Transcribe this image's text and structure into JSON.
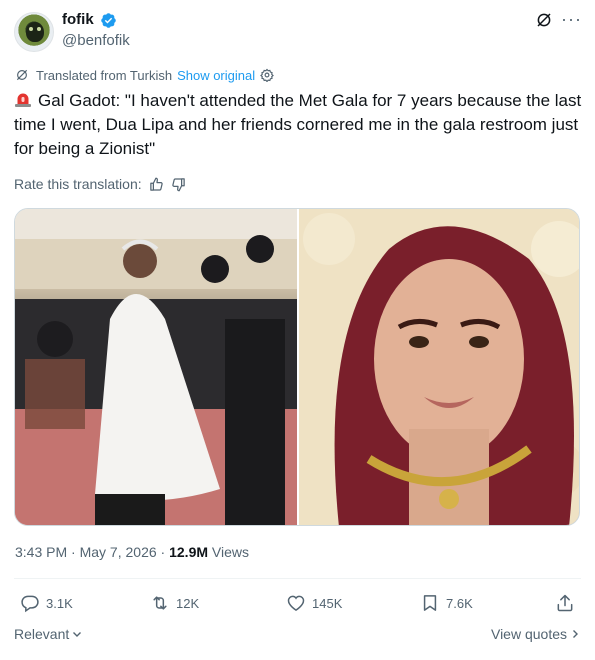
{
  "author": {
    "display_name": "fofik",
    "handle": "@benfofik",
    "verified": true,
    "avatar_icon": "avatar-image"
  },
  "header_icons": [
    "grok-icon",
    "more-icon"
  ],
  "translation": {
    "label": "Translated from Turkish",
    "show_original": "Show original",
    "settings_icon": "gear-icon"
  },
  "tweet": {
    "emoji": "siren-icon",
    "text": "Gal Gadot: \"I haven't attended the Met Gala for 7 years because the last time I went, Dua Lipa and her friends cornered me in the gala restroom just for being a Zionist\""
  },
  "rate": {
    "label": "Rate this translation:"
  },
  "media": {
    "left_photo": "photo",
    "right_photo": "photo"
  },
  "meta": {
    "time": "3:43 PM",
    "separator": "·",
    "date": "May 7, 2026",
    "views_count": "12.9M",
    "views_label": "Views"
  },
  "actions": {
    "replies": "3.1K",
    "reposts": "12K",
    "likes": "145K",
    "bookmarks": "7.6K"
  },
  "footer": {
    "relevant": "Relevant",
    "view_quotes": "View quotes"
  },
  "colors": {
    "accent": "#1d9bf0",
    "secondary_text": "#536471",
    "primary_text": "#0f1419"
  }
}
